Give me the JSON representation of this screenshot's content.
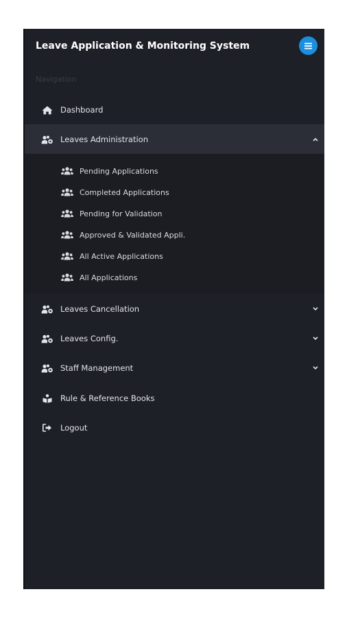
{
  "header": {
    "title": "Leave Application & Monitoring System",
    "menu_icon": "hamburger-icon",
    "accent_color": "#1a8fe0"
  },
  "navigation": {
    "section_label": "Navigation",
    "items": [
      {
        "label": "Dashboard",
        "icon": "home-icon"
      },
      {
        "label": "Leaves Administration",
        "icon": "users-cog-icon",
        "expanded": true,
        "chevron": "chevron-up-icon"
      },
      {
        "label": "Leaves Cancellation",
        "icon": "users-cog-icon",
        "chevron": "chevron-down-icon"
      },
      {
        "label": "Leaves Config.",
        "icon": "users-cog-icon",
        "chevron": "chevron-down-icon"
      },
      {
        "label": "Staff Management",
        "icon": "users-cog-icon",
        "chevron": "chevron-down-icon"
      },
      {
        "label": "Rule & Reference Books",
        "icon": "book-reader-icon"
      },
      {
        "label": "Logout",
        "icon": "sign-out-icon"
      }
    ],
    "leaves_administration_submenu": [
      {
        "label": "Pending Applications",
        "icon": "users-icon"
      },
      {
        "label": "Completed Applications",
        "icon": "users-icon"
      },
      {
        "label": "Pending for Validation",
        "icon": "users-icon"
      },
      {
        "label": "Approved & Validated Appli.",
        "icon": "users-icon"
      },
      {
        "label": "All Active Applications",
        "icon": "users-icon"
      },
      {
        "label": "All Applications",
        "icon": "users-icon"
      }
    ]
  },
  "colors": {
    "sidebar_bg": "#1e2027",
    "active_item_bg": "#2b2e36",
    "submenu_bg": "#1b1d23",
    "text": "#e3e5ea"
  }
}
